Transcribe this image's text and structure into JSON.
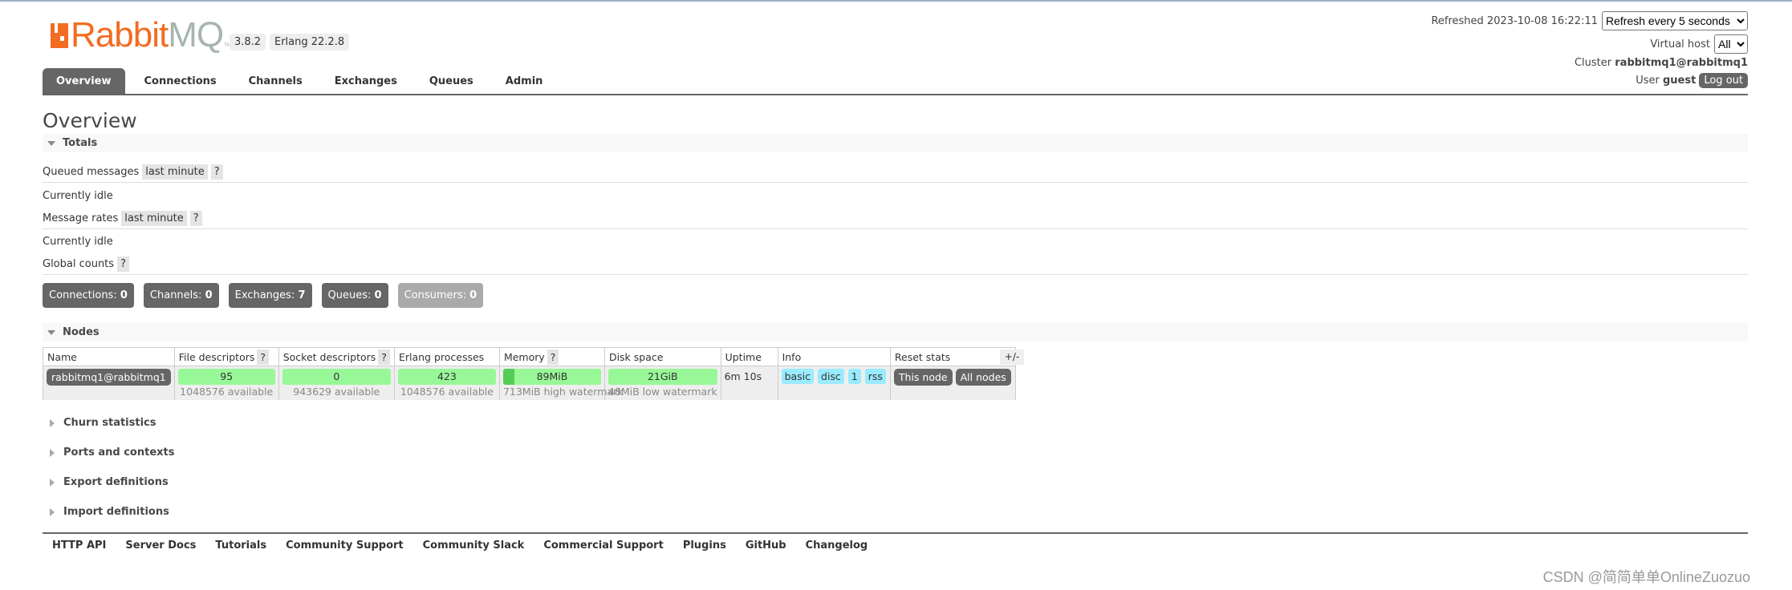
{
  "header": {
    "logo_text_a": "Rabbit",
    "logo_text_b": "MQ",
    "logo_tm": "TM",
    "version": "3.8.2",
    "erlang": "Erlang 22.2.8",
    "refreshed": "Refreshed 2023-10-08 16:22:11",
    "refresh_select": "Refresh every 5 seconds",
    "vhost_label": "Virtual host",
    "vhost_select": "All",
    "cluster_label": "Cluster",
    "cluster_name": "rabbitmq1@rabbitmq1",
    "user_label": "User",
    "user_name": "guest",
    "logout": "Log out"
  },
  "tabs": [
    {
      "label": "Overview",
      "active": true
    },
    {
      "label": "Connections"
    },
    {
      "label": "Channels"
    },
    {
      "label": "Exchanges"
    },
    {
      "label": "Queues"
    },
    {
      "label": "Admin"
    }
  ],
  "page_title": "Overview",
  "totals": {
    "title": "Totals",
    "queued_label": "Queued messages",
    "queued_range": "last minute",
    "help": "?",
    "queued_status": "Currently idle",
    "rates_label": "Message rates",
    "rates_range": "last minute",
    "rates_status": "Currently idle",
    "global_label": "Global counts",
    "counts": [
      {
        "label": "Connections:",
        "value": "0"
      },
      {
        "label": "Channels:",
        "value": "0"
      },
      {
        "label": "Exchanges:",
        "value": "7"
      },
      {
        "label": "Queues:",
        "value": "0"
      },
      {
        "label": "Consumers:",
        "value": "0"
      }
    ]
  },
  "nodes": {
    "title": "Nodes",
    "columns": [
      "Name",
      "File descriptors",
      "Socket descriptors",
      "Erlang processes",
      "Memory",
      "Disk space",
      "Uptime",
      "Info",
      "Reset stats"
    ],
    "toggle": "+/-",
    "row": {
      "name": "rabbitmq1@rabbitmq1",
      "fd": "95",
      "fd_avail": "1048576 available",
      "sd": "0",
      "sd_avail": "943629 available",
      "ep": "423",
      "ep_avail": "1048576 available",
      "mem": "89MiB",
      "mem_wm": "713MiB high watermark",
      "disk": "21GiB",
      "disk_wm": "48MiB low watermark",
      "uptime": "6m 10s",
      "info": [
        "basic",
        "disc",
        "1",
        "rss"
      ],
      "reset_this": "This node",
      "reset_all": "All nodes"
    }
  },
  "collapsed_sections": [
    "Churn statistics",
    "Ports and contexts",
    "Export definitions",
    "Import definitions"
  ],
  "footer_links": [
    "HTTP API",
    "Server Docs",
    "Tutorials",
    "Community Support",
    "Community Slack",
    "Commercial Support",
    "Plugins",
    "GitHub",
    "Changelog"
  ],
  "watermark": "CSDN @简简单单OnlineZuozuo",
  "colors": {
    "accent": "#f26c22",
    "dark": "#666666",
    "bar_green": "#98f898",
    "info_blue": "#99ebff"
  }
}
